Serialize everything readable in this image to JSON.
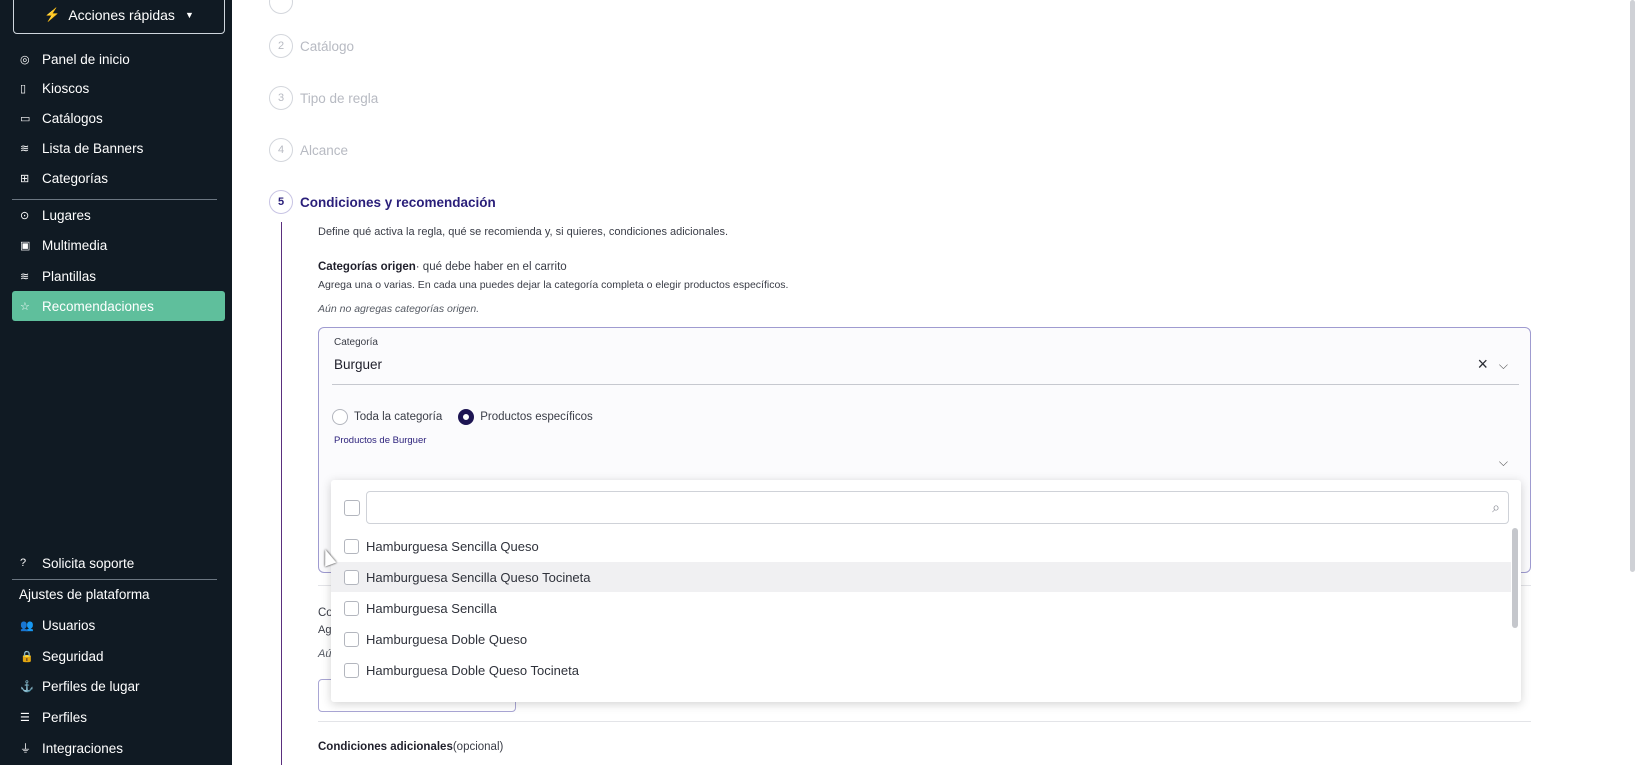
{
  "sidebar": {
    "quick_actions": "Acciones rápidas",
    "items": [
      {
        "label": "Panel de inicio",
        "icon": "dashboard-icon",
        "glyph": "◎"
      },
      {
        "label": "Kioscos",
        "icon": "kiosk-icon",
        "glyph": "▯"
      },
      {
        "label": "Catálogos",
        "icon": "book-icon",
        "glyph": "▭"
      },
      {
        "label": "Lista de Banners",
        "icon": "layers-icon",
        "glyph": "≋"
      },
      {
        "label": "Categorías",
        "icon": "boxes-icon",
        "glyph": "⊞"
      },
      {
        "label": "Lugares",
        "icon": "location-pin-icon",
        "glyph": "⊙"
      },
      {
        "label": "Multimedia",
        "icon": "image-icon",
        "glyph": "▣"
      },
      {
        "label": "Plantillas",
        "icon": "stack-icon",
        "glyph": "≋"
      },
      {
        "label": "Recomendaciones",
        "icon": "star-icon",
        "glyph": "☆"
      }
    ],
    "support": {
      "label": "Solicita soporte",
      "glyph": "?"
    },
    "settings_heading": "Ajustes de plataforma",
    "settings_items": [
      {
        "label": "Usuarios",
        "icon": "users-icon",
        "glyph": "👥"
      },
      {
        "label": "Seguridad",
        "icon": "lock-icon",
        "glyph": "🔒"
      },
      {
        "label": "Perfiles de lugar",
        "icon": "anchor-icon",
        "glyph": "⚓"
      },
      {
        "label": "Perfiles",
        "icon": "list-icon",
        "glyph": "☰"
      },
      {
        "label": "Integraciones",
        "icon": "plug-icon",
        "glyph": "⏚"
      }
    ]
  },
  "steps": [
    {
      "num": "2",
      "label": "Catálogo"
    },
    {
      "num": "3",
      "label": "Tipo de regla"
    },
    {
      "num": "4",
      "label": "Alcance"
    },
    {
      "num": "5",
      "label": "Condiciones y recomendación"
    }
  ],
  "section": {
    "description": "Define qué activa la regla, qué se recomienda y, si quieres, condiciones adicionales.",
    "origin_title": "Categorías origen",
    "origin_subtitle": "· qué debe haber en el carrito",
    "origin_help": "Agrega una o varias. En cada una puedes dejar la categoría completa o elegir productos específicos.",
    "origin_empty": "Aún no agregas categorías origen.",
    "partial_1": "Co",
    "partial_2": "Ag",
    "partial_3": "Aú",
    "additional_title": "Condiciones adicionales",
    "additional_optional": "(opcional)"
  },
  "category_card": {
    "label": "Categoría",
    "value": "Burguer",
    "radio_all": "Toda la categoría",
    "radio_specific": "Productos específicos",
    "selected_radio": "Productos específicos",
    "products_label": "Productos de Burguer"
  },
  "dropdown": {
    "items": [
      "Hamburguesa Sencilla Queso",
      "Hamburguesa Sencilla Queso Tocineta",
      "Hamburguesa Sencilla",
      "Hamburguesa Doble Queso",
      "Hamburguesa Doble Queso Tocineta"
    ],
    "hovered": "Hamburguesa Sencilla Queso Tocineta"
  },
  "colors": {
    "sidebar_bg": "#101a23",
    "active_item": "#5fbf9c",
    "accent": "#2a1f7a"
  }
}
